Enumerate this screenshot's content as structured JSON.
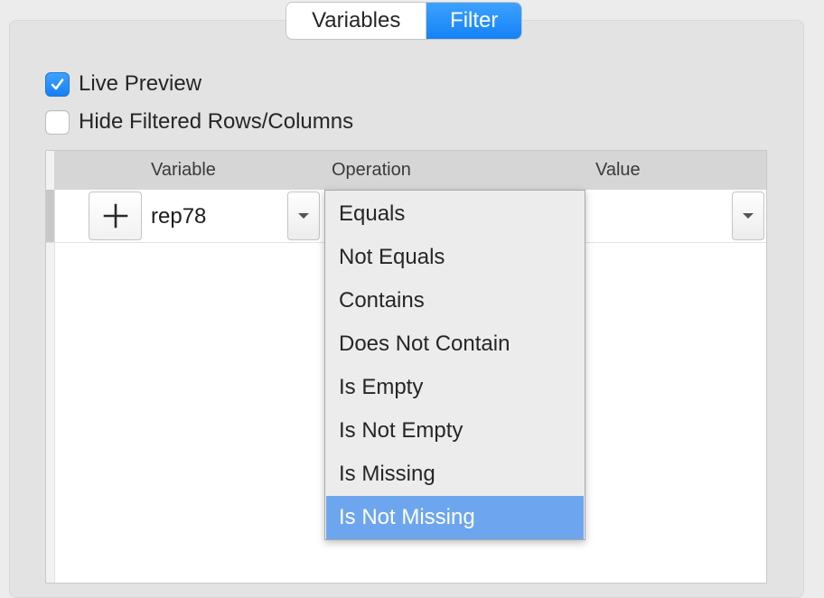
{
  "tabs": {
    "variables_label": "Variables",
    "filter_label": "Filter",
    "active": "Filter"
  },
  "options": {
    "live_preview": {
      "label": "Live Preview",
      "checked": true
    },
    "hide_filtered": {
      "label": "Hide Filtered Rows/Columns",
      "checked": false
    }
  },
  "table": {
    "headers": {
      "variable": "Variable",
      "operation": "Operation",
      "value": "Value"
    },
    "row": {
      "variable": "rep78",
      "value": ""
    }
  },
  "operation_menu": {
    "items": [
      "Equals",
      "Not Equals",
      "Contains",
      "Does Not Contain",
      "Is Empty",
      "Is Not Empty",
      "Is Missing",
      "Is Not Missing"
    ],
    "highlighted": "Is Not Missing"
  },
  "icons": {
    "add": "plus-icon",
    "dropdown": "chevron-down-icon",
    "check": "checkmark-icon"
  },
  "colors": {
    "accent": "#1a88fa",
    "menu_highlight": "#6da6ee"
  }
}
